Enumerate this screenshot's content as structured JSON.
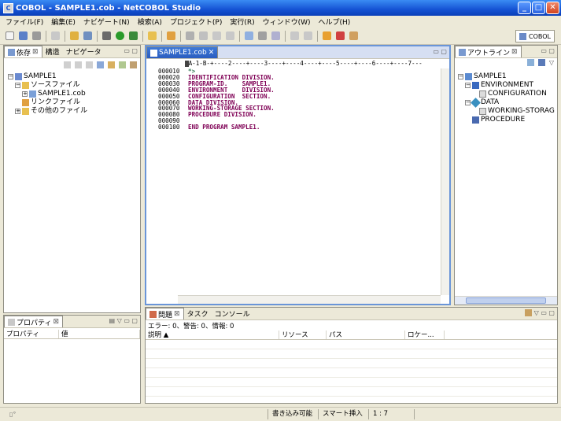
{
  "window": {
    "title": "COBOL - SAMPLE1.cob - NetCOBOL Studio"
  },
  "menu": [
    "ファイル(F)",
    "編集(E)",
    "ナビゲート(N)",
    "検索(A)",
    "プロジェクト(P)",
    "実行(R)",
    "ウィンドウ(W)",
    "ヘルプ(H)"
  ],
  "toolbar": {
    "perspective_label": "COBOL"
  },
  "left_panel": {
    "tabs": [
      "依存",
      "構造",
      "ナビゲータ"
    ],
    "tree": [
      {
        "label": "SAMPLE1",
        "level": 0,
        "icon": "project-icon"
      },
      {
        "label": "ソースファイル",
        "level": 1,
        "icon": "folder-icon"
      },
      {
        "label": "SAMPLE1.cob",
        "level": 2,
        "icon": "cobol-file-icon"
      },
      {
        "label": "リンクファイル",
        "level": 1,
        "icon": "link-icon"
      },
      {
        "label": "その他のファイル",
        "level": 1,
        "icon": "folder-icon"
      }
    ]
  },
  "properties_panel": {
    "tab": "プロパティ",
    "columns": [
      "プロパティ",
      "値"
    ]
  },
  "editor": {
    "tab_label": "SAMPLE1.cob",
    "ruler": "A-1-B-+----2----+----3----+----4----+----5----+----6----+----7---",
    "lines": [
      {
        "num": "000010",
        "text": "*>",
        "kind": "comment"
      },
      {
        "num": "000020",
        "text": "IDENTIFICATION DIVISION.",
        "kind": "code"
      },
      {
        "num": "000030",
        "text": "PROGRAM-ID.    SAMPLE1.",
        "kind": "code"
      },
      {
        "num": "000040",
        "text": "ENVIRONMENT    DIVISION.",
        "kind": "code"
      },
      {
        "num": "000050",
        "text": "CONFIGURATION  SECTION.",
        "kind": "code"
      },
      {
        "num": "000060",
        "text": "DATA DIVISION.",
        "kind": "code"
      },
      {
        "num": "000070",
        "text": "WORKING-STORAGE SECTION.",
        "kind": "code"
      },
      {
        "num": "000080",
        "text": "PROCEDURE DIVISION.",
        "kind": "code"
      },
      {
        "num": "000090",
        "text": "",
        "kind": "code"
      },
      {
        "num": "000100",
        "text": "END PROGRAM SAMPLE1.",
        "kind": "code"
      }
    ]
  },
  "outline_panel": {
    "tab": "アウトライン",
    "tree": [
      {
        "label": "SAMPLE1",
        "level": 0,
        "icon": "program-icon"
      },
      {
        "label": "ENVIRONMENT",
        "level": 1,
        "icon": "environment-icon"
      },
      {
        "label": "CONFIGURATION",
        "level": 2,
        "icon": "section-icon"
      },
      {
        "label": "DATA",
        "level": 1,
        "icon": "data-icon"
      },
      {
        "label": "WORKING-STORAG",
        "level": 2,
        "icon": "section-icon"
      },
      {
        "label": "PROCEDURE",
        "level": 1,
        "icon": "procedure-icon"
      }
    ]
  },
  "bottom_panel": {
    "tabs": [
      "問題",
      "タスク",
      "コンソール"
    ],
    "summary": "エラー: 0、警告: 0、情報: 0",
    "columns": [
      "説明",
      "リソース",
      "パス",
      "ロケー..."
    ]
  },
  "status": {
    "writable": "書き込み可能",
    "insert_mode": "スマート挿入",
    "position": "1 : 7"
  }
}
